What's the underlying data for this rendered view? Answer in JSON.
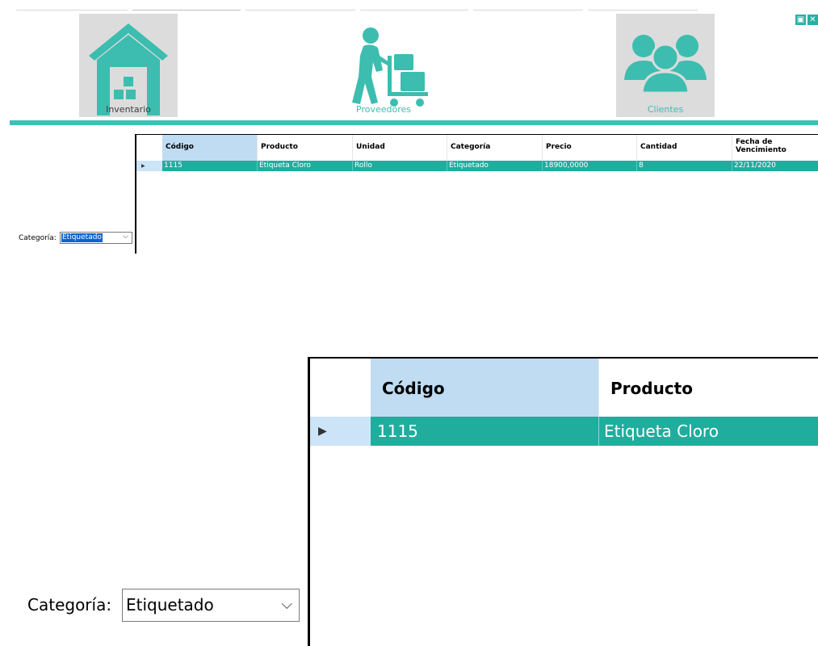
{
  "nav": {
    "inventario": {
      "label": "Inventario",
      "icon": "warehouse-icon"
    },
    "proveedores": {
      "label": "Proveedores",
      "icon": "delivery-worker-icon"
    },
    "clientes": {
      "label": "Clientes",
      "icon": "users-group-icon"
    }
  },
  "window_buttons": {
    "restore": {
      "icon": "restore-icon",
      "glyph": "▣"
    },
    "close": {
      "icon": "close-icon",
      "glyph": "✕"
    }
  },
  "filter": {
    "label": "Categoría:",
    "selected": "Etiquetado",
    "chevron": "⌵"
  },
  "grid": {
    "columns": [
      "Código",
      "Producto",
      "Unidad",
      "Categoría",
      "Precio",
      "Cantidad",
      "Fecha de Vencimiento"
    ],
    "rows": [
      [
        "1115",
        "Etiqueta Cloro",
        "Rollo",
        "Etiquetado",
        "18900,0000",
        "8",
        "22/11/2020"
      ]
    ],
    "row_indicator": "▶"
  },
  "colors": {
    "accent": "#3cc1b3",
    "selected_row": "#20ad9e",
    "header_highlight": "#bfdcf2",
    "icon_bg": "#dcdcdc"
  }
}
